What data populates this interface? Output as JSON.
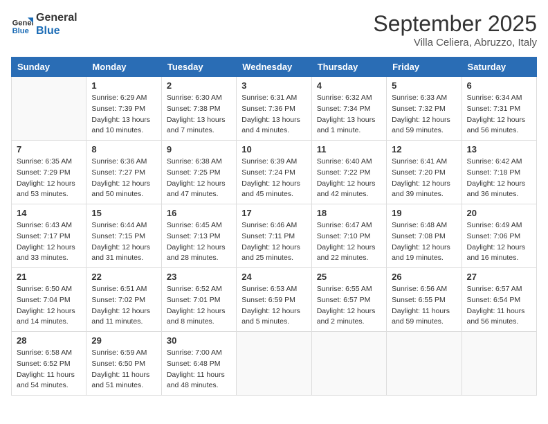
{
  "logo": {
    "line1": "General",
    "line2": "Blue"
  },
  "title": "September 2025",
  "subtitle": "Villa Celiera, Abruzzo, Italy",
  "days_of_week": [
    "Sunday",
    "Monday",
    "Tuesday",
    "Wednesday",
    "Thursday",
    "Friday",
    "Saturday"
  ],
  "weeks": [
    [
      {
        "day": "",
        "info": ""
      },
      {
        "day": "1",
        "info": "Sunrise: 6:29 AM\nSunset: 7:39 PM\nDaylight: 13 hours\nand 10 minutes."
      },
      {
        "day": "2",
        "info": "Sunrise: 6:30 AM\nSunset: 7:38 PM\nDaylight: 13 hours\nand 7 minutes."
      },
      {
        "day": "3",
        "info": "Sunrise: 6:31 AM\nSunset: 7:36 PM\nDaylight: 13 hours\nand 4 minutes."
      },
      {
        "day": "4",
        "info": "Sunrise: 6:32 AM\nSunset: 7:34 PM\nDaylight: 13 hours\nand 1 minute."
      },
      {
        "day": "5",
        "info": "Sunrise: 6:33 AM\nSunset: 7:32 PM\nDaylight: 12 hours\nand 59 minutes."
      },
      {
        "day": "6",
        "info": "Sunrise: 6:34 AM\nSunset: 7:31 PM\nDaylight: 12 hours\nand 56 minutes."
      }
    ],
    [
      {
        "day": "7",
        "info": "Sunrise: 6:35 AM\nSunset: 7:29 PM\nDaylight: 12 hours\nand 53 minutes."
      },
      {
        "day": "8",
        "info": "Sunrise: 6:36 AM\nSunset: 7:27 PM\nDaylight: 12 hours\nand 50 minutes."
      },
      {
        "day": "9",
        "info": "Sunrise: 6:38 AM\nSunset: 7:25 PM\nDaylight: 12 hours\nand 47 minutes."
      },
      {
        "day": "10",
        "info": "Sunrise: 6:39 AM\nSunset: 7:24 PM\nDaylight: 12 hours\nand 45 minutes."
      },
      {
        "day": "11",
        "info": "Sunrise: 6:40 AM\nSunset: 7:22 PM\nDaylight: 12 hours\nand 42 minutes."
      },
      {
        "day": "12",
        "info": "Sunrise: 6:41 AM\nSunset: 7:20 PM\nDaylight: 12 hours\nand 39 minutes."
      },
      {
        "day": "13",
        "info": "Sunrise: 6:42 AM\nSunset: 7:18 PM\nDaylight: 12 hours\nand 36 minutes."
      }
    ],
    [
      {
        "day": "14",
        "info": "Sunrise: 6:43 AM\nSunset: 7:17 PM\nDaylight: 12 hours\nand 33 minutes."
      },
      {
        "day": "15",
        "info": "Sunrise: 6:44 AM\nSunset: 7:15 PM\nDaylight: 12 hours\nand 31 minutes."
      },
      {
        "day": "16",
        "info": "Sunrise: 6:45 AM\nSunset: 7:13 PM\nDaylight: 12 hours\nand 28 minutes."
      },
      {
        "day": "17",
        "info": "Sunrise: 6:46 AM\nSunset: 7:11 PM\nDaylight: 12 hours\nand 25 minutes."
      },
      {
        "day": "18",
        "info": "Sunrise: 6:47 AM\nSunset: 7:10 PM\nDaylight: 12 hours\nand 22 minutes."
      },
      {
        "day": "19",
        "info": "Sunrise: 6:48 AM\nSunset: 7:08 PM\nDaylight: 12 hours\nand 19 minutes."
      },
      {
        "day": "20",
        "info": "Sunrise: 6:49 AM\nSunset: 7:06 PM\nDaylight: 12 hours\nand 16 minutes."
      }
    ],
    [
      {
        "day": "21",
        "info": "Sunrise: 6:50 AM\nSunset: 7:04 PM\nDaylight: 12 hours\nand 14 minutes."
      },
      {
        "day": "22",
        "info": "Sunrise: 6:51 AM\nSunset: 7:02 PM\nDaylight: 12 hours\nand 11 minutes."
      },
      {
        "day": "23",
        "info": "Sunrise: 6:52 AM\nSunset: 7:01 PM\nDaylight: 12 hours\nand 8 minutes."
      },
      {
        "day": "24",
        "info": "Sunrise: 6:53 AM\nSunset: 6:59 PM\nDaylight: 12 hours\nand 5 minutes."
      },
      {
        "day": "25",
        "info": "Sunrise: 6:55 AM\nSunset: 6:57 PM\nDaylight: 12 hours\nand 2 minutes."
      },
      {
        "day": "26",
        "info": "Sunrise: 6:56 AM\nSunset: 6:55 PM\nDaylight: 11 hours\nand 59 minutes."
      },
      {
        "day": "27",
        "info": "Sunrise: 6:57 AM\nSunset: 6:54 PM\nDaylight: 11 hours\nand 56 minutes."
      }
    ],
    [
      {
        "day": "28",
        "info": "Sunrise: 6:58 AM\nSunset: 6:52 PM\nDaylight: 11 hours\nand 54 minutes."
      },
      {
        "day": "29",
        "info": "Sunrise: 6:59 AM\nSunset: 6:50 PM\nDaylight: 11 hours\nand 51 minutes."
      },
      {
        "day": "30",
        "info": "Sunrise: 7:00 AM\nSunset: 6:48 PM\nDaylight: 11 hours\nand 48 minutes."
      },
      {
        "day": "",
        "info": ""
      },
      {
        "day": "",
        "info": ""
      },
      {
        "day": "",
        "info": ""
      },
      {
        "day": "",
        "info": ""
      }
    ]
  ]
}
